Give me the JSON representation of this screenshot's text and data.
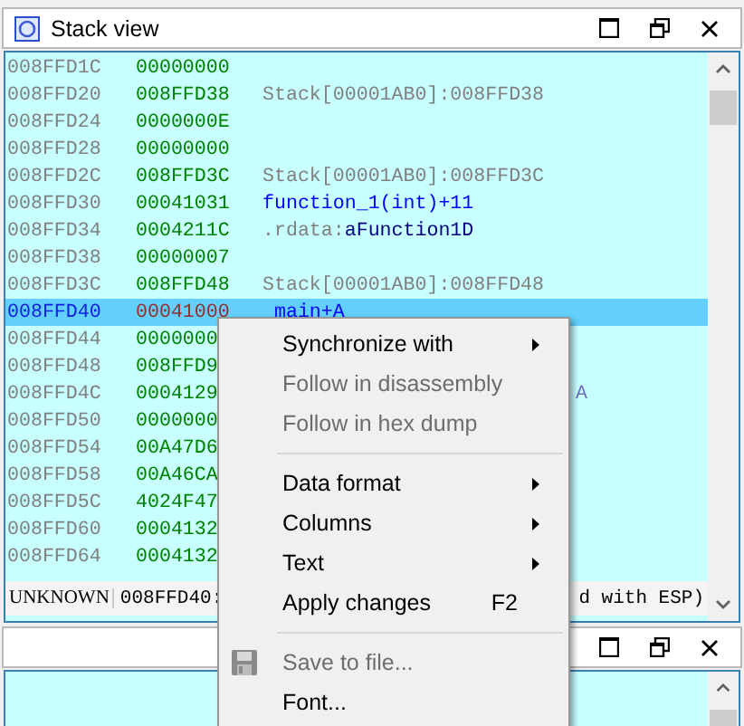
{
  "stack_view": {
    "title": "Stack view",
    "rows": [
      {
        "address": "008FFD1C",
        "value": "00000000",
        "selected": false,
        "comment": []
      },
      {
        "address": "008FFD20",
        "value": "008FFD38",
        "selected": false,
        "comment": [
          {
            "kind": "stack",
            "text": "Stack[00001AB0]:008FFD38"
          }
        ]
      },
      {
        "address": "008FFD24",
        "value": "0000000E",
        "selected": false,
        "comment": []
      },
      {
        "address": "008FFD28",
        "value": "00000000",
        "selected": false,
        "comment": []
      },
      {
        "address": "008FFD2C",
        "value": "008FFD3C",
        "selected": false,
        "comment": [
          {
            "kind": "stack",
            "text": "Stack[00001AB0]:008FFD3C"
          }
        ]
      },
      {
        "address": "008FFD30",
        "value": "00041031",
        "selected": false,
        "comment": [
          {
            "kind": "code",
            "text": "function_1(int)+11"
          }
        ]
      },
      {
        "address": "008FFD34",
        "value": "0004211C",
        "selected": false,
        "comment": [
          {
            "kind": "stack",
            "text": ".rdata:"
          },
          {
            "kind": "data",
            "text": "aFunction1D"
          }
        ]
      },
      {
        "address": "008FFD38",
        "value": "00000007",
        "selected": false,
        "comment": []
      },
      {
        "address": "008FFD3C",
        "value": "008FFD48",
        "selected": false,
        "comment": [
          {
            "kind": "stack",
            "text": "Stack[00001AB0]:008FFD48"
          }
        ]
      },
      {
        "address": "008FFD40",
        "value": "00041000",
        "selected": true,
        "comment": [
          {
            "kind": "code",
            "text": " main+A"
          }
        ]
      },
      {
        "address": "008FFD44",
        "value": "0000000",
        "selected": false,
        "comment": []
      },
      {
        "address": "008FFD48",
        "value": "008FFD9",
        "selected": false,
        "comment": []
      },
      {
        "address": "008FFD4C",
        "value": "0004129",
        "selected": false,
        "comment": [
          {
            "kind": "hidden_tail",
            "text": "A"
          }
        ]
      },
      {
        "address": "008FFD50",
        "value": "0000000",
        "selected": false,
        "comment": []
      },
      {
        "address": "008FFD54",
        "value": "00A47D6",
        "selected": false,
        "comment": []
      },
      {
        "address": "008FFD58",
        "value": "00A46CA",
        "selected": false,
        "comment": []
      },
      {
        "address": "008FFD5C",
        "value": "4024F47",
        "selected": false,
        "comment": []
      },
      {
        "address": "008FFD60",
        "value": "0004132",
        "selected": false,
        "comment": []
      },
      {
        "address": "008FFD64",
        "value": "0004132",
        "selected": false,
        "comment": []
      }
    ],
    "status_bar": {
      "segment": "UNKNOWN",
      "address": "008FFD40:",
      "tail": "d with ESP)"
    }
  },
  "context_menu": {
    "items": [
      {
        "kind": "item",
        "label": "Synchronize with",
        "disabled": false,
        "submenu": true
      },
      {
        "kind": "item",
        "label": "Follow in disassembly",
        "disabled": true,
        "submenu": false
      },
      {
        "kind": "item",
        "label": "Follow in hex dump",
        "disabled": true,
        "submenu": false
      },
      {
        "kind": "separator"
      },
      {
        "kind": "item",
        "label": "Data format",
        "disabled": false,
        "submenu": true
      },
      {
        "kind": "item",
        "label": "Columns",
        "disabled": false,
        "submenu": true
      },
      {
        "kind": "item",
        "label": "Text",
        "disabled": false,
        "submenu": true
      },
      {
        "kind": "item",
        "label": "Apply changes",
        "disabled": false,
        "submenu": false,
        "shortcut": "F2"
      },
      {
        "kind": "separator"
      },
      {
        "kind": "icon_item",
        "label": "Save to file...",
        "disabled": true,
        "submenu": false
      },
      {
        "kind": "item",
        "label": "Font...",
        "disabled": false,
        "submenu": false
      }
    ]
  }
}
